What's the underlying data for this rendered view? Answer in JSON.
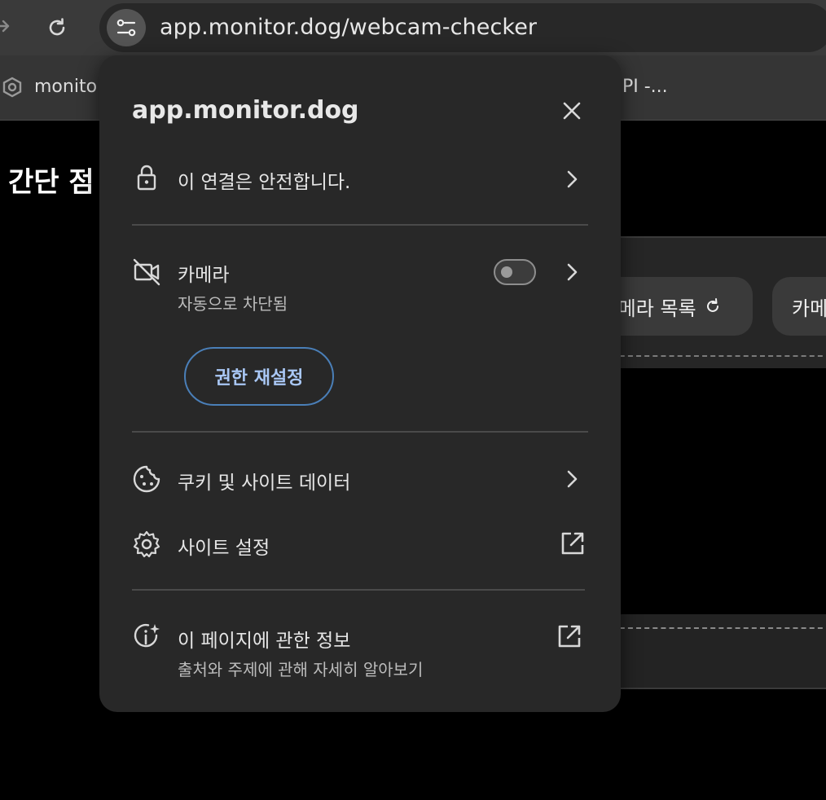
{
  "browser": {
    "url": "app.monitor.dog/webcam-checker",
    "bookmarks": [
      "monito",
      "PI -..."
    ]
  },
  "page": {
    "heading": "간단 점",
    "refresh_list_label": "-메라 목록",
    "camera_button_label": "카메"
  },
  "popup": {
    "title": "app.monitor.dog",
    "connection_label": "이 연결은 안전합니다.",
    "camera": {
      "label": "카메라",
      "status": "자동으로 차단됨",
      "toggle_on": false
    },
    "reset_button": "권한 재설정",
    "cookies_label": "쿠키 및 사이트 데이터",
    "site_settings_label": "사이트 설정",
    "about": {
      "label": "이 페이지에 관한 정보",
      "sub": "출처와 주제에 관해 자세히 알아보기"
    }
  },
  "colors": {
    "popup_bg": "#282828",
    "accent_blue": "#a9c7f5",
    "button_border": "#4a7fb8"
  }
}
